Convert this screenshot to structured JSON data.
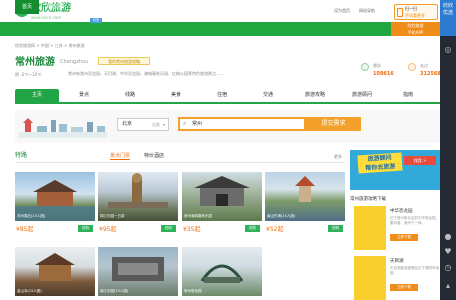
{
  "header": {
    "logo_glyph": "◕",
    "logo_text": "欣欣旅游",
    "logo_url": "www.cncn.com",
    "links": [
      "设为首页",
      "网站导航"
    ],
    "scan": {
      "line1": "扫一扫",
      "line2": "手机看更多"
    }
  },
  "nav": {
    "items": [
      "首页",
      "旅游顾问",
      "欣欣优选",
      "跟团游",
      "自助游",
      "主题游",
      "自驾游",
      "攻略",
      "百宝箱"
    ],
    "badge": "特惠",
    "app": {
      "line1": "欣欣旅游",
      "line2": "手机APP"
    }
  },
  "breadcrumb": "欣欣旅游网 > 中国 > 江苏 > 常州旅游",
  "city": {
    "name": "常州旅游",
    "pinyin": "Changzhou",
    "intro_button": "我的常州旅游攻略",
    "weather": "阴 -2℃~10℃",
    "description": "常州有常州恐龙园、天目湖、中华恐龙园、淹城春秋乐园、红梅公园等特色旅游景点……"
  },
  "stats": [
    {
      "label": "想去",
      "value": "108616"
    },
    {
      "label": "去过",
      "value": "312568"
    }
  ],
  "tabs": [
    "主页",
    "景点",
    "线路",
    "美食",
    "住宿",
    "交通",
    "旅游攻略",
    "旅游顾问",
    "指南"
  ],
  "search": {
    "from_label": "北京",
    "from_hint": "出发",
    "query": "常州",
    "button": "提交需求"
  },
  "section": {
    "title": "特路",
    "subtabs": [
      "景点门票",
      "特价酒店"
    ],
    "more": "更多"
  },
  "cards": [
    {
      "caption": "苏州周庄(15人团)",
      "price": "¥85起",
      "buy": "抢购"
    },
    {
      "caption": "锦江乐园一日游",
      "price": "¥95起",
      "buy": "抢购"
    },
    {
      "caption": "常州淹城春秋乐园",
      "price": "¥35起",
      "buy": "抢购"
    },
    {
      "caption": "南山竹海(15人团)",
      "price": "¥52起",
      "buy": "抢购"
    },
    {
      "caption": "金山寺(15人团)",
      "price": "",
      "buy": ""
    },
    {
      "caption": "锦江乐园(15人团)",
      "price": "",
      "buy": ""
    },
    {
      "caption": "常州恐龙园",
      "price": "",
      "buy": ""
    }
  ],
  "sidebar": {
    "promo": {
      "line1": "旅游顾问",
      "line2": "帮你去旅游",
      "cta": "找我 >"
    },
    "download_title": "常州旅游攻略下载",
    "guides": [
      {
        "name": "中华恐龙园",
        "desc": "位于常州新北区的中华恐龙园，集科普、娱乐于一体。",
        "button": "立即下载"
      },
      {
        "name": "天目湖",
        "desc": "天目湖旅游度假区位于溧阳市南部。",
        "button": "立即下载"
      }
    ]
  },
  "right_rail": {
    "cta_lines": [
      "欣欣",
      "优选"
    ],
    "icons": [
      "weibo-icon",
      "wechat-icon",
      "heart-icon",
      "clock-icon",
      "top-icon"
    ]
  }
}
